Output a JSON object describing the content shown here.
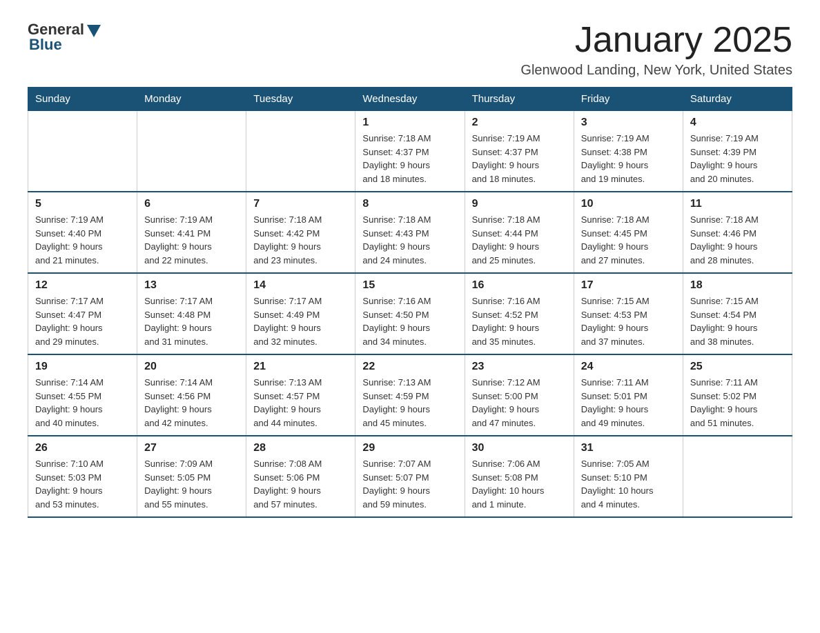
{
  "logo": {
    "general": "General",
    "blue": "Blue"
  },
  "header": {
    "title": "January 2025",
    "subtitle": "Glenwood Landing, New York, United States"
  },
  "weekdays": [
    "Sunday",
    "Monday",
    "Tuesday",
    "Wednesday",
    "Thursday",
    "Friday",
    "Saturday"
  ],
  "weeks": [
    [
      {
        "day": "",
        "info": ""
      },
      {
        "day": "",
        "info": ""
      },
      {
        "day": "",
        "info": ""
      },
      {
        "day": "1",
        "info": "Sunrise: 7:18 AM\nSunset: 4:37 PM\nDaylight: 9 hours\nand 18 minutes."
      },
      {
        "day": "2",
        "info": "Sunrise: 7:19 AM\nSunset: 4:37 PM\nDaylight: 9 hours\nand 18 minutes."
      },
      {
        "day": "3",
        "info": "Sunrise: 7:19 AM\nSunset: 4:38 PM\nDaylight: 9 hours\nand 19 minutes."
      },
      {
        "day": "4",
        "info": "Sunrise: 7:19 AM\nSunset: 4:39 PM\nDaylight: 9 hours\nand 20 minutes."
      }
    ],
    [
      {
        "day": "5",
        "info": "Sunrise: 7:19 AM\nSunset: 4:40 PM\nDaylight: 9 hours\nand 21 minutes."
      },
      {
        "day": "6",
        "info": "Sunrise: 7:19 AM\nSunset: 4:41 PM\nDaylight: 9 hours\nand 22 minutes."
      },
      {
        "day": "7",
        "info": "Sunrise: 7:18 AM\nSunset: 4:42 PM\nDaylight: 9 hours\nand 23 minutes."
      },
      {
        "day": "8",
        "info": "Sunrise: 7:18 AM\nSunset: 4:43 PM\nDaylight: 9 hours\nand 24 minutes."
      },
      {
        "day": "9",
        "info": "Sunrise: 7:18 AM\nSunset: 4:44 PM\nDaylight: 9 hours\nand 25 minutes."
      },
      {
        "day": "10",
        "info": "Sunrise: 7:18 AM\nSunset: 4:45 PM\nDaylight: 9 hours\nand 27 minutes."
      },
      {
        "day": "11",
        "info": "Sunrise: 7:18 AM\nSunset: 4:46 PM\nDaylight: 9 hours\nand 28 minutes."
      }
    ],
    [
      {
        "day": "12",
        "info": "Sunrise: 7:17 AM\nSunset: 4:47 PM\nDaylight: 9 hours\nand 29 minutes."
      },
      {
        "day": "13",
        "info": "Sunrise: 7:17 AM\nSunset: 4:48 PM\nDaylight: 9 hours\nand 31 minutes."
      },
      {
        "day": "14",
        "info": "Sunrise: 7:17 AM\nSunset: 4:49 PM\nDaylight: 9 hours\nand 32 minutes."
      },
      {
        "day": "15",
        "info": "Sunrise: 7:16 AM\nSunset: 4:50 PM\nDaylight: 9 hours\nand 34 minutes."
      },
      {
        "day": "16",
        "info": "Sunrise: 7:16 AM\nSunset: 4:52 PM\nDaylight: 9 hours\nand 35 minutes."
      },
      {
        "day": "17",
        "info": "Sunrise: 7:15 AM\nSunset: 4:53 PM\nDaylight: 9 hours\nand 37 minutes."
      },
      {
        "day": "18",
        "info": "Sunrise: 7:15 AM\nSunset: 4:54 PM\nDaylight: 9 hours\nand 38 minutes."
      }
    ],
    [
      {
        "day": "19",
        "info": "Sunrise: 7:14 AM\nSunset: 4:55 PM\nDaylight: 9 hours\nand 40 minutes."
      },
      {
        "day": "20",
        "info": "Sunrise: 7:14 AM\nSunset: 4:56 PM\nDaylight: 9 hours\nand 42 minutes."
      },
      {
        "day": "21",
        "info": "Sunrise: 7:13 AM\nSunset: 4:57 PM\nDaylight: 9 hours\nand 44 minutes."
      },
      {
        "day": "22",
        "info": "Sunrise: 7:13 AM\nSunset: 4:59 PM\nDaylight: 9 hours\nand 45 minutes."
      },
      {
        "day": "23",
        "info": "Sunrise: 7:12 AM\nSunset: 5:00 PM\nDaylight: 9 hours\nand 47 minutes."
      },
      {
        "day": "24",
        "info": "Sunrise: 7:11 AM\nSunset: 5:01 PM\nDaylight: 9 hours\nand 49 minutes."
      },
      {
        "day": "25",
        "info": "Sunrise: 7:11 AM\nSunset: 5:02 PM\nDaylight: 9 hours\nand 51 minutes."
      }
    ],
    [
      {
        "day": "26",
        "info": "Sunrise: 7:10 AM\nSunset: 5:03 PM\nDaylight: 9 hours\nand 53 minutes."
      },
      {
        "day": "27",
        "info": "Sunrise: 7:09 AM\nSunset: 5:05 PM\nDaylight: 9 hours\nand 55 minutes."
      },
      {
        "day": "28",
        "info": "Sunrise: 7:08 AM\nSunset: 5:06 PM\nDaylight: 9 hours\nand 57 minutes."
      },
      {
        "day": "29",
        "info": "Sunrise: 7:07 AM\nSunset: 5:07 PM\nDaylight: 9 hours\nand 59 minutes."
      },
      {
        "day": "30",
        "info": "Sunrise: 7:06 AM\nSunset: 5:08 PM\nDaylight: 10 hours\nand 1 minute."
      },
      {
        "day": "31",
        "info": "Sunrise: 7:05 AM\nSunset: 5:10 PM\nDaylight: 10 hours\nand 4 minutes."
      },
      {
        "day": "",
        "info": ""
      }
    ]
  ]
}
